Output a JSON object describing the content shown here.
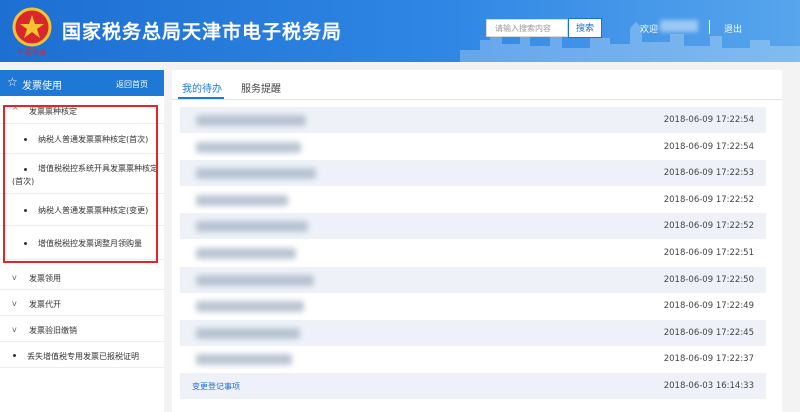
{
  "header": {
    "site_title": "国家税务总局天津市电子税务局",
    "search_placeholder": "请输入搜索内容",
    "search_button": "搜索",
    "welcome": "欢迎",
    "logout": "退出",
    "gradient_start": "#1d6fd1",
    "gradient_end": "#57a5ec"
  },
  "sidebar": {
    "title": "发票使用",
    "back_home": "返回首页",
    "items": [
      {
        "type": "group",
        "label": "发票票种核定",
        "expanded": true
      },
      {
        "type": "sub",
        "label": "纳税人普通发票票种核定(首次)"
      },
      {
        "type": "sub",
        "label": "增值税税控系统开具发票票种核定(首次)"
      },
      {
        "type": "sub",
        "label": "纳税人普通发票票种核定(变更)"
      },
      {
        "type": "sub",
        "label": "增值税税控发票调整月领购量"
      },
      {
        "type": "group",
        "label": "发票领用",
        "expanded": false
      },
      {
        "type": "group",
        "label": "发票代开",
        "expanded": false
      },
      {
        "type": "group",
        "label": "发票验旧缴销",
        "expanded": false
      },
      {
        "type": "sub",
        "label": "丢失增值税专用发票已报税证明"
      }
    ]
  },
  "main": {
    "tabs": [
      "我的待办",
      "服务提醒"
    ],
    "active_tab": "我的待办",
    "accent": "#1d78d6",
    "rows": [
      {
        "title": "",
        "time": "2018-06-09 17:22:54"
      },
      {
        "title": "",
        "time": "2018-06-09 17:22:54"
      },
      {
        "title": "",
        "time": "2018-06-09 17:22:53"
      },
      {
        "title": "",
        "time": "2018-06-09 17:22:52"
      },
      {
        "title": "",
        "time": "2018-06-09 17:22:52"
      },
      {
        "title": "",
        "time": "2018-06-09 17:22:51"
      },
      {
        "title": "",
        "time": "2018-06-09 17:22:50"
      },
      {
        "title": "",
        "time": "2018-06-09 17:22:49"
      },
      {
        "title": "",
        "time": "2018-06-09 17:22:45"
      },
      {
        "title": "",
        "time": "2018-06-09 17:22:37"
      },
      {
        "title": "变更登记事项",
        "time": "2018-06-03 16:14:33"
      }
    ]
  },
  "highlight_color": "#e0262b"
}
